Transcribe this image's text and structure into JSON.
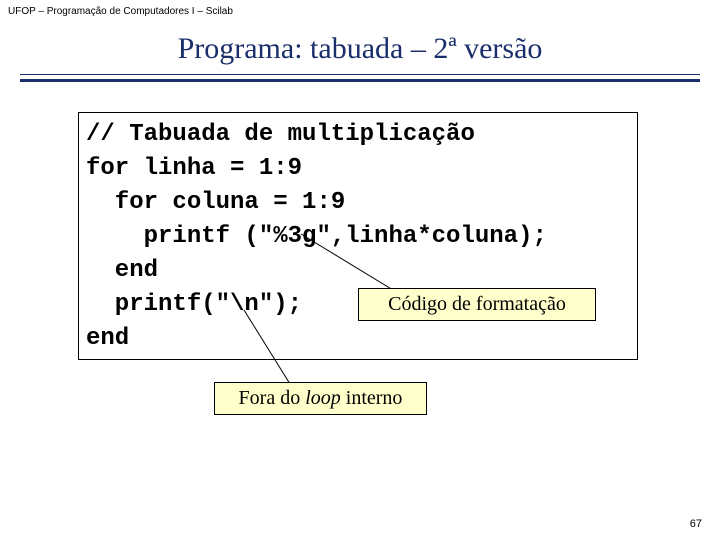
{
  "header": "UFOP – Programação de Computadores I – Scilab",
  "title": "Programa: tabuada – 2ª versão",
  "code": {
    "l1": "// Tabuada de multiplicação",
    "l2": "for linha = 1:9",
    "l3": "  for coluna = 1:9",
    "l4": "    printf (\"%3g\",linha*coluna);",
    "l5": "  end",
    "l6": "  printf(\"\\n\");",
    "l7": "end"
  },
  "callouts": {
    "format": "Código de formatação",
    "loop_prefix": "Fora do ",
    "loop_italic": "loop",
    "loop_suffix": " interno"
  },
  "page": "67"
}
